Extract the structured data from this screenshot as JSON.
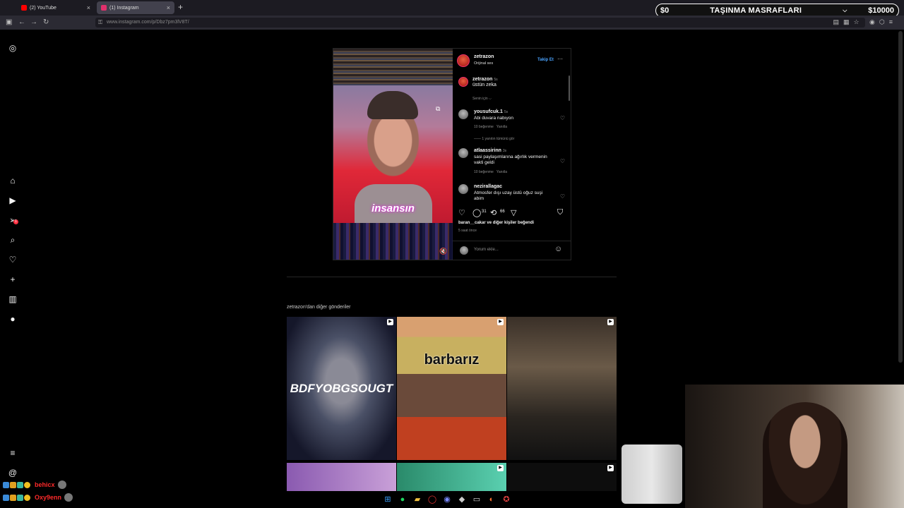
{
  "browser": {
    "tabs": [
      {
        "title": "(2) YouTube",
        "favicon_color": "#ff0000",
        "active": false
      },
      {
        "title": "(1) Instagram",
        "favicon_color": "#e1306c",
        "active": true
      }
    ],
    "url": "www.instagram.com/p/Dbz7pm3lV8T/"
  },
  "donation_bar": {
    "left_amount": "$0",
    "title": "TAŞINMA MASRAFLARI",
    "right_amount": "$10000"
  },
  "sidebar": {
    "notification_badge": "1",
    "icons": [
      "instagram-icon",
      "home-icon",
      "reels-icon",
      "messages-icon",
      "search-icon",
      "notifications-icon",
      "create-icon",
      "dashboard-icon",
      "profile-icon",
      "menu-icon",
      "threads-icon"
    ]
  },
  "post": {
    "author": "zetrazon",
    "audio": "Orijinal ses",
    "follow_label": "Takip Et",
    "more": "···",
    "caption_author": "zetrazon",
    "caption_time": "5s",
    "caption": "üstün zeka",
    "sort_label": "Senin için ⌵",
    "reel_text": "insansın",
    "comments": [
      {
        "user": "yousufcuk.1",
        "time": "5s",
        "text": "Abi duvara nabıyon",
        "likes": "10 beğenme",
        "reply": "Yanıtla",
        "view_replies": "1 yanıtın tümünü gör"
      },
      {
        "user": "atlaassirinn",
        "time": "3s",
        "text": "sasi paylaşımlarına ağırlık vermenin vakti geldi",
        "likes": "10 beğenme",
        "reply": "Yanıtla"
      },
      {
        "user": "nezirallagac",
        "time": "4s",
        "text": "Atmosfer dışı uzay üstü oğuz suşi abim"
      }
    ],
    "comment_count": "31",
    "repost_count": "66",
    "liked_by": "baran__cakar ve diğer kişiler beğendi",
    "posted_ago": "5 saat önce",
    "comment_placeholder": "Yorum ekle..."
  },
  "more_posts": {
    "title": "zetrazon'dan diğer gönderiler",
    "items": [
      {
        "caption": "BDFYOBGSOUGT"
      },
      {
        "caption": "barbarız"
      },
      {
        "caption": ""
      },
      {
        "caption": ""
      },
      {
        "caption": ""
      },
      {
        "caption": ""
      }
    ]
  },
  "chat": [
    {
      "name": "behicx"
    },
    {
      "name": "Oxy9enn"
    }
  ],
  "colors": {
    "accent": "#4aa3ff",
    "like_red": "#ff3040",
    "chat_name": "#ff2a2a"
  }
}
